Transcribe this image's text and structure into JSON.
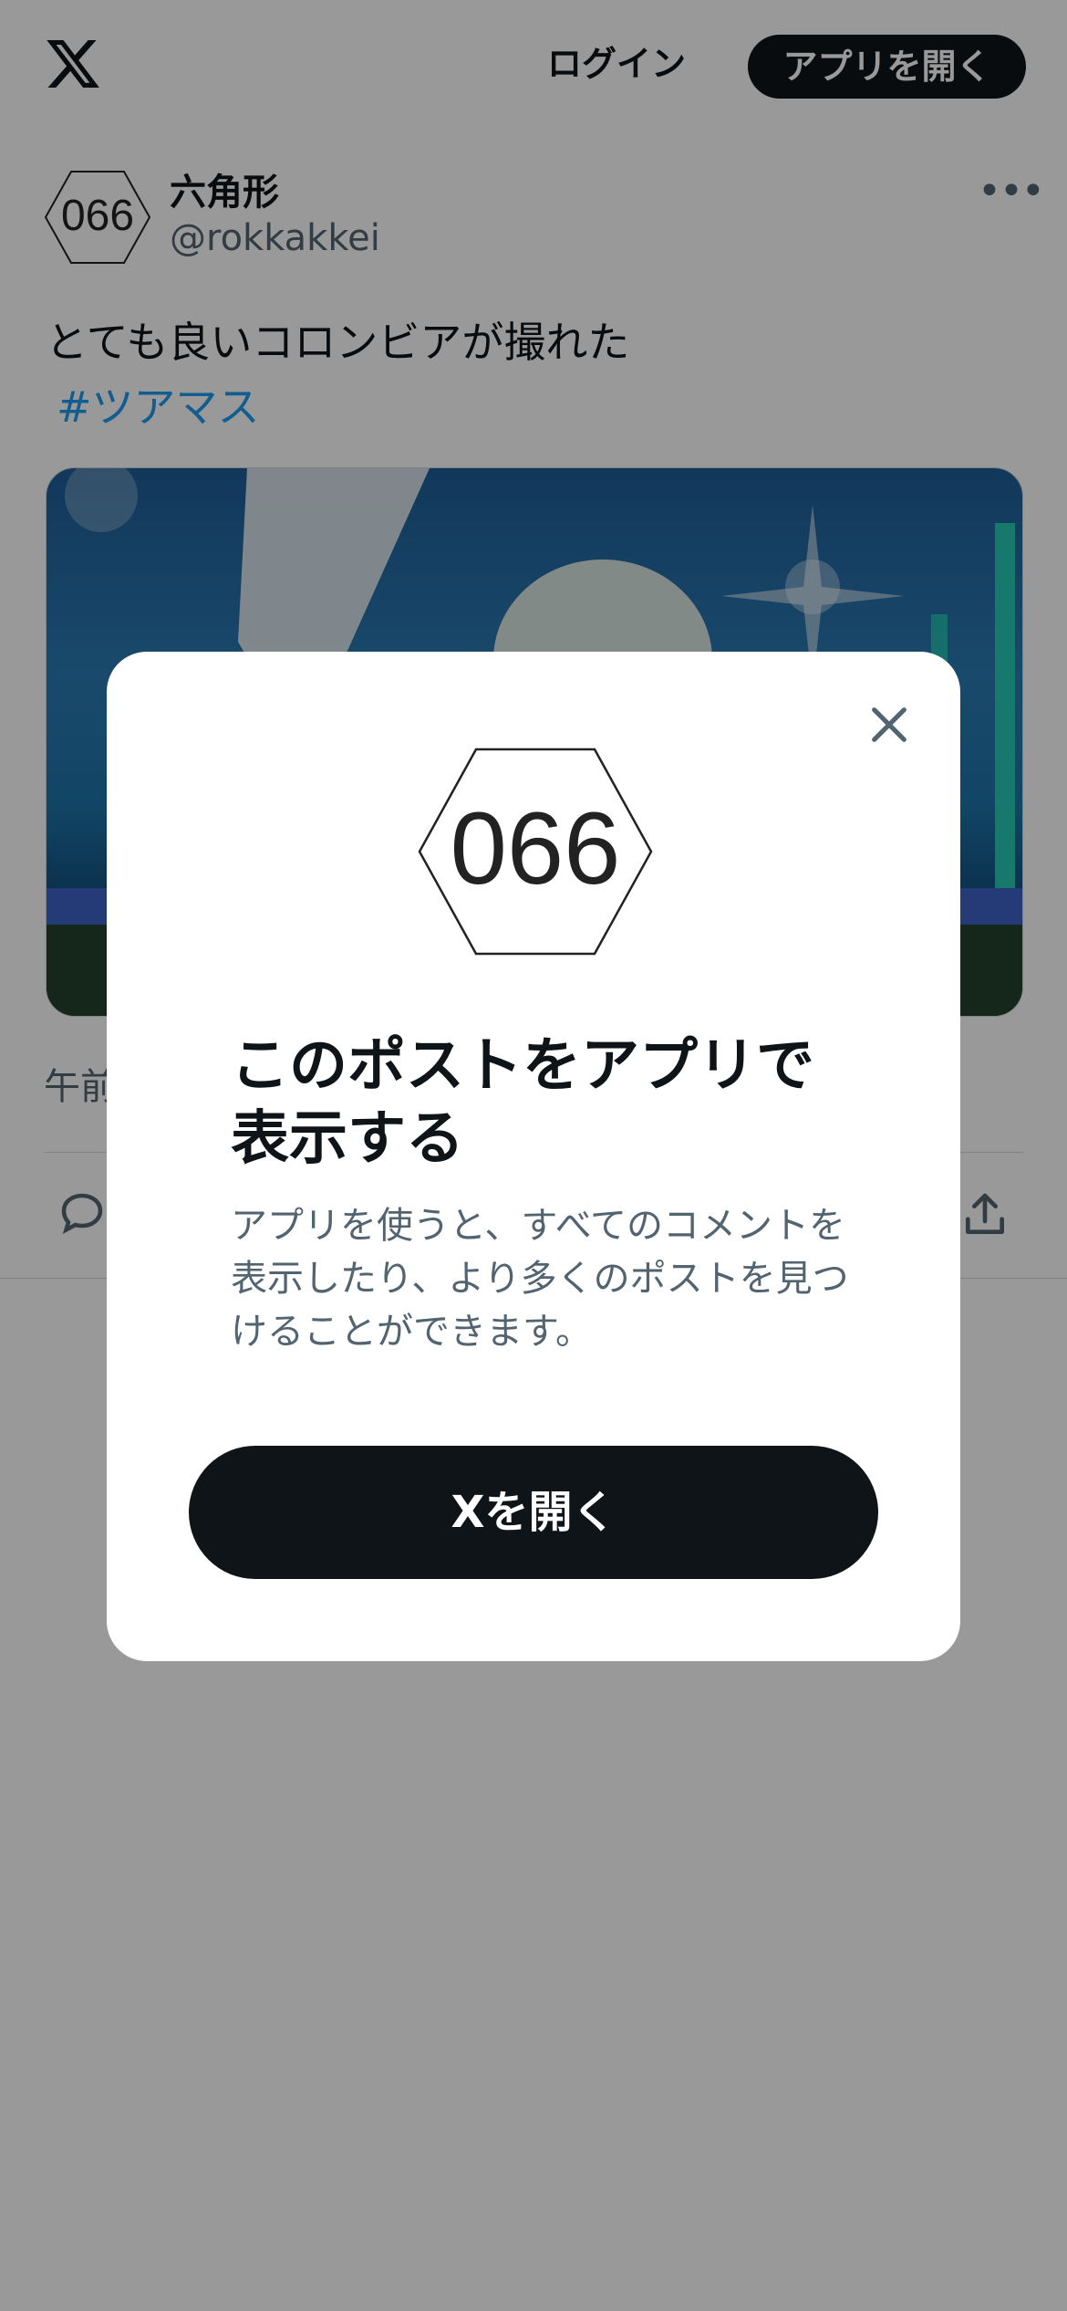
{
  "header": {
    "logo_icon": "x-logo-icon",
    "login_label": "ログイン",
    "open_app_label": "アプリを開く"
  },
  "post": {
    "display_name": "六角形",
    "handle": "@rokkakkei",
    "avatar_text": "066",
    "text": "とても良いコロンビアが撮れた",
    "hashtag": "#ツアマス",
    "timestamp_partial": "午前",
    "more_icon": "more-icon"
  },
  "actions": {
    "reply_icon": "reply-icon",
    "share_icon": "share-icon"
  },
  "modal": {
    "logo_text": "066",
    "title": "このポストをアプリで表示する",
    "description": "アプリを使うと、すべてのコメントを表示したり、より多くのポストを見つけることができます。",
    "open_button_label": "Xを開く",
    "close_icon": "close-icon"
  },
  "colors": {
    "accent": "#1d9bf0",
    "primary_text": "#0f1419",
    "secondary_text": "#536471",
    "button_dark": "#0f1419"
  }
}
